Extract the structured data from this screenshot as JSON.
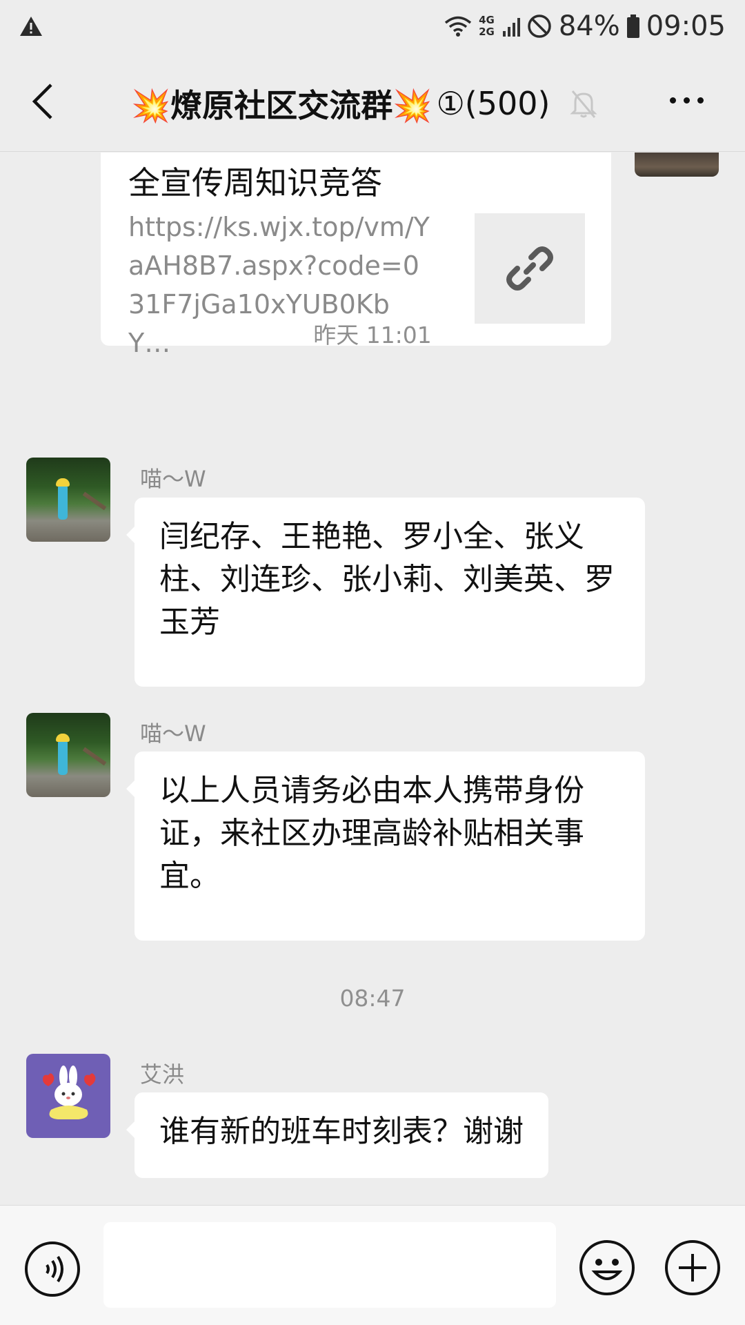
{
  "status_bar": {
    "net_top": "4G",
    "net_bottom": "2G",
    "battery": "84%",
    "time": "09:05"
  },
  "header": {
    "title": "💥燎原社区交流群💥",
    "member_count": "①(500)"
  },
  "link_card": {
    "title": "全宣传周知识竞答",
    "url": "https://ks.wjx.top/vm/YaAH8B7.aspx?code=031F7jGa10xYUB0KbY…"
  },
  "timestamps": [
    "昨天 11:01",
    "08:47"
  ],
  "messages": [
    {
      "sender": "喵～W",
      "text": "闫纪存、王艳艳、罗小全、张义柱、刘连珍、张小莉、刘美英、罗玉芳"
    },
    {
      "sender": "喵～W",
      "text": "以上人员请务必由本人携带身份证，来社区办理高龄补贴相关事宜。"
    },
    {
      "sender": "艾洪",
      "text": "谁有新的班车时刻表？谢谢"
    }
  ],
  "input": {
    "placeholder": ""
  },
  "icons": [
    "warning-icon",
    "wifi-icon",
    "signal-icon",
    "do-not-disturb-icon",
    "battery-icon",
    "back-icon",
    "mute-bell-icon",
    "more-icon",
    "link-icon",
    "voice-icon",
    "emoji-icon",
    "plus-icon"
  ],
  "colors": {
    "background": "#ededed",
    "bubble": "#ffffff",
    "meta_text": "#8f8f8f"
  }
}
